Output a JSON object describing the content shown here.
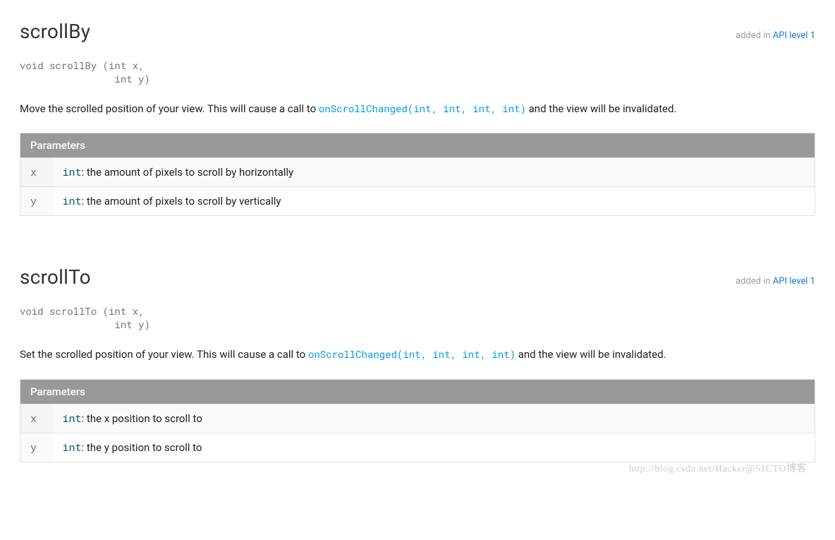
{
  "methods": [
    {
      "name": "scrollBy",
      "added_prefix": "added in ",
      "added_link": "API level 1",
      "signature": "void scrollBy (int x, \n                int y)",
      "desc_before": "Move the scrolled position of your view. This will cause a call to ",
      "desc_link": "onScrollChanged(int, int, int, int)",
      "desc_after": " and the view will be invalidated.",
      "params_header": "Parameters",
      "params": [
        {
          "name": "x",
          "type": "int",
          "colon": ": ",
          "desc": "the amount of pixels to scroll by horizontally"
        },
        {
          "name": "y",
          "type": "int",
          "colon": ": ",
          "desc": "the amount of pixels to scroll by vertically"
        }
      ]
    },
    {
      "name": "scrollTo",
      "added_prefix": "added in ",
      "added_link": "API level 1",
      "signature": "void scrollTo (int x, \n                int y)",
      "desc_before": "Set the scrolled position of your view. This will cause a call to ",
      "desc_link": "onScrollChanged(int, int, int, int)",
      "desc_after": " and the view will be invalidated.",
      "params_header": "Parameters",
      "params": [
        {
          "name": "x",
          "type": "int",
          "colon": ": ",
          "desc": "the x position to scroll to"
        },
        {
          "name": "y",
          "type": "int",
          "colon": ": ",
          "desc": "the y position to scroll to"
        }
      ]
    }
  ],
  "watermark": "http://blog.csdn.net/Hacker@51CTO博客"
}
